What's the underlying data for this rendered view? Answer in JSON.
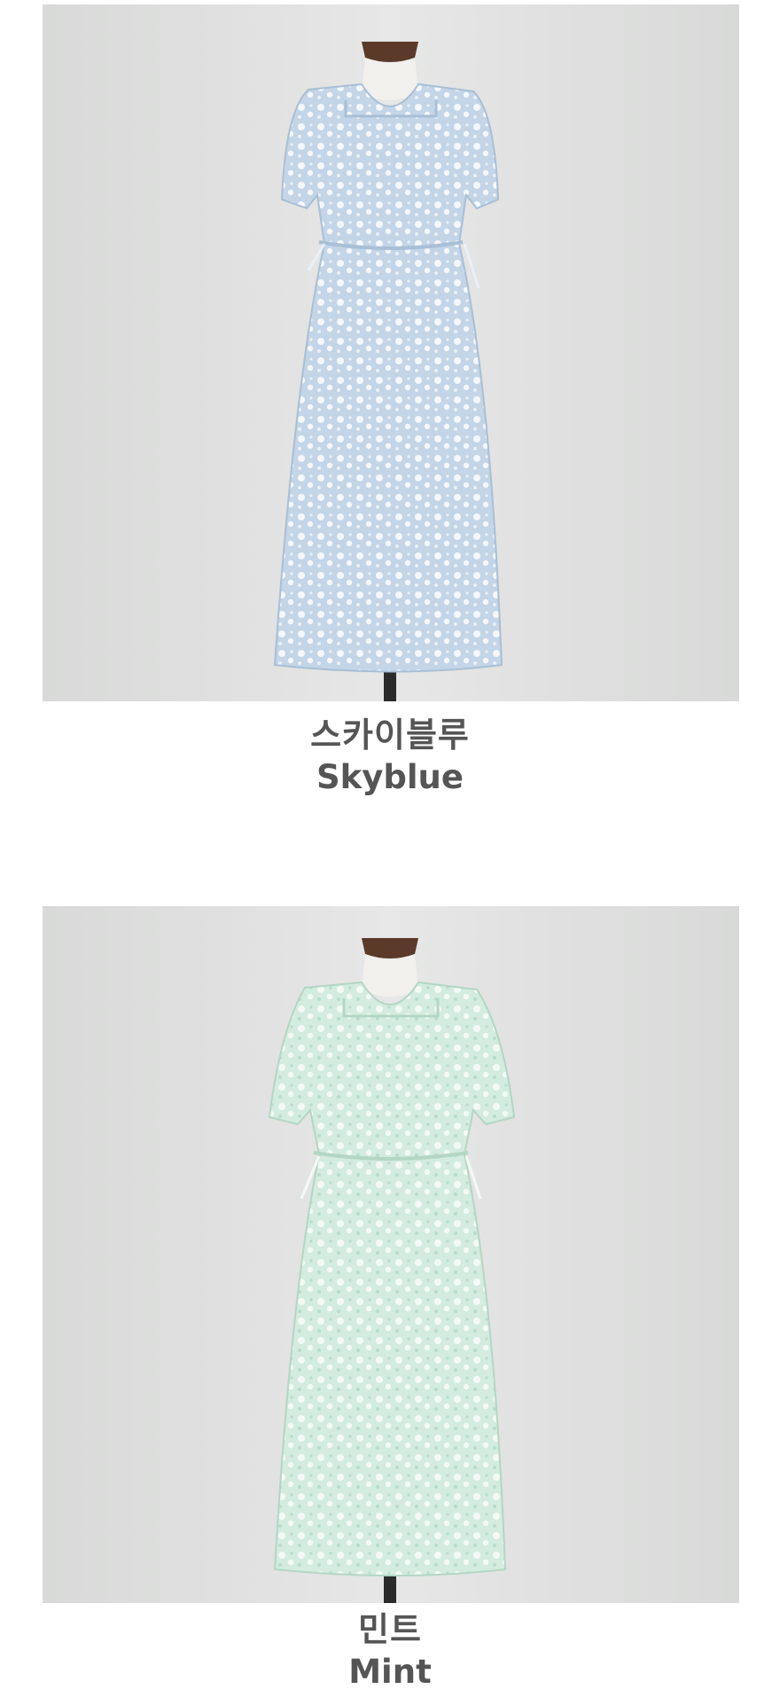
{
  "products": [
    {
      "name_ko": "스카이블루",
      "name_en": "Skyblue",
      "image_alt": "Skyblue floral dress on mannequin",
      "colors": {
        "fabric": "#c3d5e6",
        "pattern": "#f4f7fb",
        "shade": "#a9bfd6"
      }
    },
    {
      "name_ko": "민트",
      "name_en": "Mint",
      "image_alt": "Mint floral dress on mannequin",
      "colors": {
        "fabric": "#d3ecdf",
        "pattern": "#f3faf6",
        "shade": "#b4d6c4"
      }
    }
  ],
  "background_colors": {
    "backdrop": "#e3e4e3",
    "backdrop_edge": "#d8d9d8",
    "mannequin": "#f2f0ec",
    "cap": "#5b3a2a",
    "stand": "#2b2b2b"
  }
}
